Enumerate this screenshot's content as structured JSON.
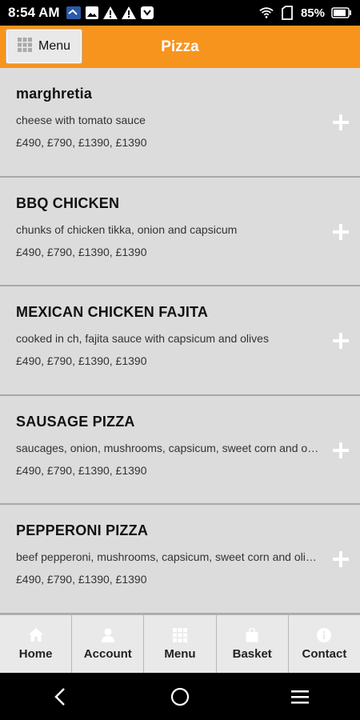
{
  "status_bar": {
    "time": "8:54 AM",
    "battery": "85%"
  },
  "header": {
    "menu_button_label": "Menu",
    "title": "Pizza"
  },
  "items": [
    {
      "name": "marghretia",
      "description": "cheese with tomato sauce",
      "prices": "£490, £790, £1390, £1390"
    },
    {
      "name": "BBQ CHICKEN",
      "description": "chunks of chicken tikka, onion and capsicum",
      "prices": "£490, £790, £1390, £1390"
    },
    {
      "name": "MEXICAN CHICKEN FAJITA",
      "description": "cooked in ch, fajita sauce with capsicum and olives",
      "prices": "£490, £790, £1390, £1390"
    },
    {
      "name": "SAUSAGE PIZZA",
      "description": "saucages, onion, mushrooms, capsicum, sweet corn and olives",
      "prices": "£490, £790, £1390, £1390"
    },
    {
      "name": "PEPPERONI PIZZA",
      "description": "beef pepperoni, mushrooms, capsicum, sweet corn and olives",
      "prices": "£490, £790, £1390, £1390"
    }
  ],
  "bottom_nav": [
    {
      "label": "Home",
      "icon": "home-icon"
    },
    {
      "label": "Account",
      "icon": "user-icon"
    },
    {
      "label": "Menu",
      "icon": "grid-icon"
    },
    {
      "label": "Basket",
      "icon": "basket-icon"
    },
    {
      "label": "Contact",
      "icon": "info-icon"
    }
  ],
  "colors": {
    "header": "#f7941d",
    "background": "#dcdcdc",
    "nav": "#e9e9e9"
  }
}
